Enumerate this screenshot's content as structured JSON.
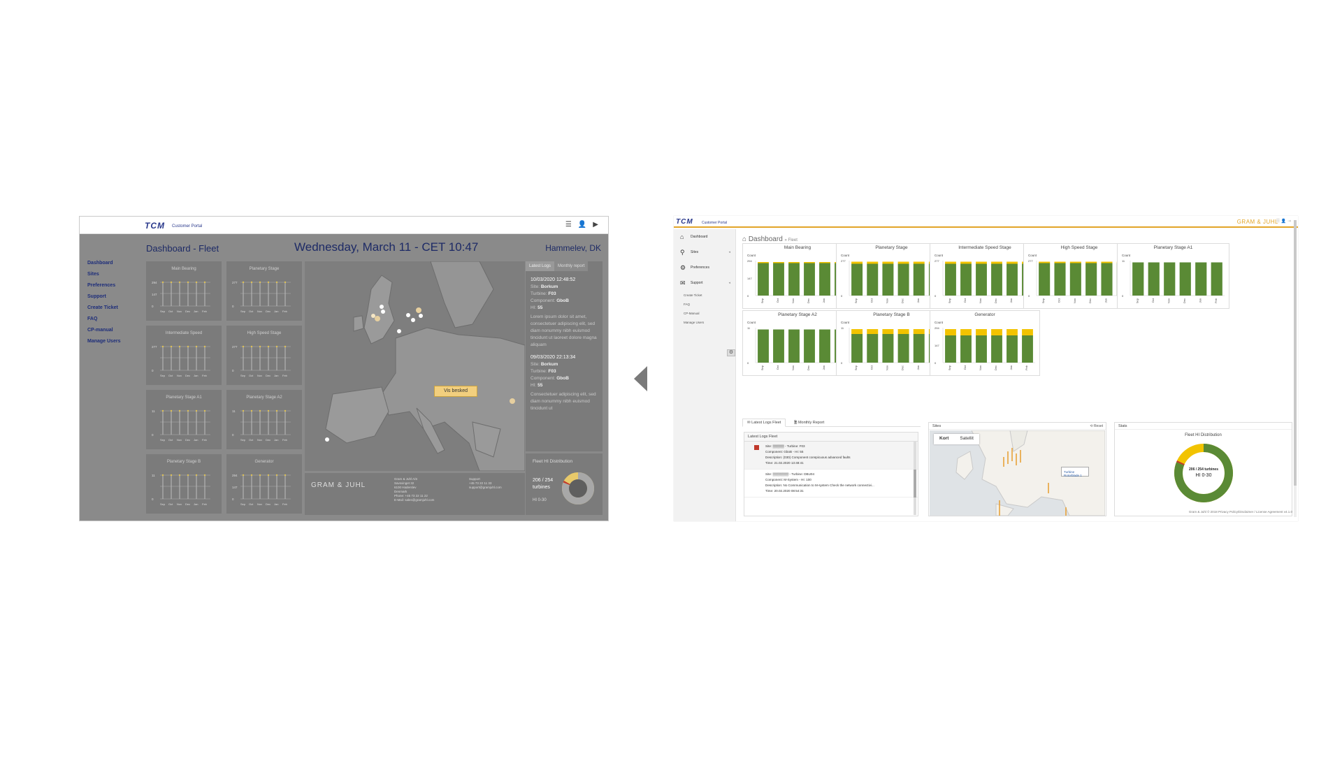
{
  "left_mockup": {
    "logo": "TCM",
    "logo_suffix": "Customer Portal",
    "nav": [
      "Dashboard",
      "Sites",
      "Preferences",
      "Support",
      "Create Ticket",
      "FAQ",
      "CP-manual",
      "Manage Users"
    ],
    "title": "Dashboard  - Fleet",
    "datetime": "Wednesday, March 11 - CET 10:47",
    "location": "Hammelev, DK",
    "panels": [
      {
        "title": "Main Bearing",
        "yticks": [
          "294",
          "147",
          "0"
        ]
      },
      {
        "title": "Planetary Stage",
        "yticks": [
          "277",
          "",
          "0"
        ]
      },
      {
        "title": "Intermediate Speed",
        "yticks": [
          "277",
          "",
          "0"
        ]
      },
      {
        "title": "High Speed Stage",
        "yticks": [
          "277",
          "",
          "0"
        ]
      },
      {
        "title": "Planetary Stage A1",
        "yticks": [
          "11",
          "",
          "0"
        ]
      },
      {
        "title": "Planetary Stage A2",
        "yticks": [
          "11",
          "",
          "0"
        ]
      },
      {
        "title": "Planetary Stage B",
        "yticks": [
          "11",
          "",
          "0"
        ]
      },
      {
        "title": "Generator",
        "yticks": [
          "294",
          "147",
          "0"
        ]
      }
    ],
    "months": [
      "Sep",
      "Oct",
      "Nov",
      "Dec",
      "Jan",
      "Feb"
    ],
    "map_popup": "Vis besked",
    "log_tabs": [
      "Latest Logs",
      "Monthly report"
    ],
    "logs": [
      {
        "date": "10/03/2020 12:48:52",
        "site_label": "Site: ",
        "site": "Borkum",
        "turbine_label": "Turbine: ",
        "turbine": "F03",
        "component_label": "Component: ",
        "component": "GboB",
        "hi_label": "HI: ",
        "hi": "55",
        "text": "Lorem ipsum dolor sit amet, consectetuer adipiscing elit, sed diam nonummy nibh euismod tincidunt ut laoreet dolore magna aliquam"
      },
      {
        "date": "09/03/2020 22:13:34",
        "site_label": "Site: ",
        "site": "Borkum",
        "turbine_label": "Turbine: ",
        "turbine": "F03",
        "component_label": "Component: ",
        "component": "GboB",
        "hi_label": "HI: ",
        "hi": "55",
        "text": "Consectetuer adipiscing elit, sed diam nonummy nibh euismod tincidunt ut"
      }
    ],
    "footer": {
      "brand": "GRAM & JUHL",
      "address": [
        "Gram & Juhl A/S",
        "Savsvinget 32",
        "6100 Haderslev",
        "Denmark",
        "Phone: +45 73 22 11 22",
        "E-Mail: sales@gramjuhl.com"
      ],
      "support": [
        "Support",
        "+45 73 22 11 33",
        "support@gramjuhl.com"
      ]
    },
    "fleet": {
      "title": "Fleet HI Distribution",
      "count": "206 / 254",
      "unit": "turbines",
      "range": "HI 0-30",
      "fraction": 0.81
    }
  },
  "right_screenshot": {
    "logo": "TCM",
    "logo_suffix": "Customer Portal",
    "brand": "GRAM & JUHL",
    "nav": [
      {
        "icon": "home-icon",
        "glyph": "⌂",
        "label": "Dashboard"
      },
      {
        "icon": "turbine-icon",
        "glyph": "⚲",
        "label": "Sites"
      },
      {
        "icon": "gear-icon",
        "glyph": "⚙",
        "label": "Preferences"
      },
      {
        "icon": "chat-icon",
        "glyph": "✉",
        "label": "Support"
      }
    ],
    "subnav": [
      "Create Ticket",
      "FAQ",
      "CP-Manual",
      "Manage Users"
    ],
    "page_title": "Dashboard",
    "page_sub": "» Fleet",
    "charts": [
      {
        "title": "Main Bearing",
        "ylabel": "Count",
        "yticks": [
          "294",
          "147",
          "0"
        ],
        "green": [
          0.93,
          0.93,
          0.93,
          0.93,
          0.93,
          0.93
        ],
        "yellow": [
          0.03,
          0.03,
          0.03,
          0.03,
          0.03,
          0.03
        ]
      },
      {
        "title": "Planetary Stage",
        "ylabel": "Count",
        "yticks": [
          "277",
          "",
          "0"
        ],
        "green": [
          0.91,
          0.91,
          0.91,
          0.91,
          0.91,
          0.91
        ],
        "yellow": [
          0.06,
          0.06,
          0.06,
          0.06,
          0.06,
          0.06
        ]
      },
      {
        "title": "Intermediate Speed Stage",
        "ylabel": "Count",
        "yticks": [
          "277",
          "",
          "0"
        ],
        "green": [
          0.91,
          0.91,
          0.91,
          0.91,
          0.91,
          0.91
        ],
        "yellow": [
          0.06,
          0.06,
          0.06,
          0.06,
          0.06,
          0.06
        ]
      },
      {
        "title": "High Speed Stage",
        "ylabel": "Count",
        "yticks": [
          "277",
          "",
          "0"
        ],
        "green": [
          0.93,
          0.93,
          0.93,
          0.93,
          0.93,
          0.93
        ],
        "yellow": [
          0.04,
          0.04,
          0.04,
          0.04,
          0.04,
          0.04
        ]
      },
      {
        "title": "Planetary Stage A1",
        "ylabel": "Count",
        "yticks": [
          "11",
          "",
          "0"
        ],
        "green": [
          0.95,
          0.95,
          0.95,
          0.95,
          0.95,
          0.95
        ],
        "yellow": [
          0,
          0,
          0,
          0,
          0,
          0
        ]
      },
      {
        "title": "Planetary Stage A2",
        "ylabel": "Count",
        "yticks": [
          "11",
          "",
          "0"
        ],
        "green": [
          0.95,
          0.95,
          0.95,
          0.95,
          0.95,
          0.95
        ],
        "yellow": [
          0,
          0,
          0,
          0,
          0,
          0
        ]
      },
      {
        "title": "Planetary Stage B",
        "ylabel": "Count",
        "yticks": [
          "11",
          "",
          "0"
        ],
        "green": [
          0.82,
          0.82,
          0.82,
          0.82,
          0.82,
          0.82
        ],
        "yellow": [
          0.14,
          0.14,
          0.14,
          0.14,
          0.14,
          0.14
        ]
      },
      {
        "title": "Generator",
        "ylabel": "Count",
        "yticks": [
          "294",
          "147",
          "0"
        ],
        "green": [
          0.78,
          0.78,
          0.78,
          0.78,
          0.78,
          0.78
        ],
        "yellow": [
          0.18,
          0.18,
          0.18,
          0.18,
          0.18,
          0.18
        ]
      }
    ],
    "months": [
      "Sep",
      "Oct",
      "Nov",
      "Dec",
      "Jan",
      "Feb"
    ],
    "tabs": [
      "Latest Logs Fleet",
      "Monthly Report"
    ],
    "logs_header": "Latest Logs Fleet",
    "logs": [
      {
        "site": "Site: ▒▒▒▒▒ - Turbine: F03",
        "component": "Component: GboB - HI: 55",
        "desc": "Description: (030) Component conspicuous advanced faults",
        "time": "Time: 21.02.2020 13:48:41"
      },
      {
        "site": "Site: ▒▒▒▒▒▒▒ - Turbine: DBU04",
        "component": "Component: M-System - HI: 100",
        "desc": "Description: No Communication to M-system Check the network connectivi...",
        "time": "Time: 20.02.2020 08:54:31"
      }
    ],
    "sites_header": "Sites",
    "reset": "⟲ Reset",
    "map_buttons": [
      "Kort",
      "Satellit"
    ],
    "map_tip": "Turbine Rotorblade 1",
    "stats_header": "Stats",
    "stats_title": "Fleet HI Distribution",
    "donut_count": "206 / 254 turbines",
    "donut_range": "HI 0-30",
    "donut_fraction": 0.81,
    "footer": "Gram & Juhl © 2018 Privacy Policy/Disclaimer / License Agreement v4.1.0",
    "colors": {
      "green": "#5a8a35",
      "yellow": "#f2c300",
      "orange": "#e2a528"
    }
  }
}
